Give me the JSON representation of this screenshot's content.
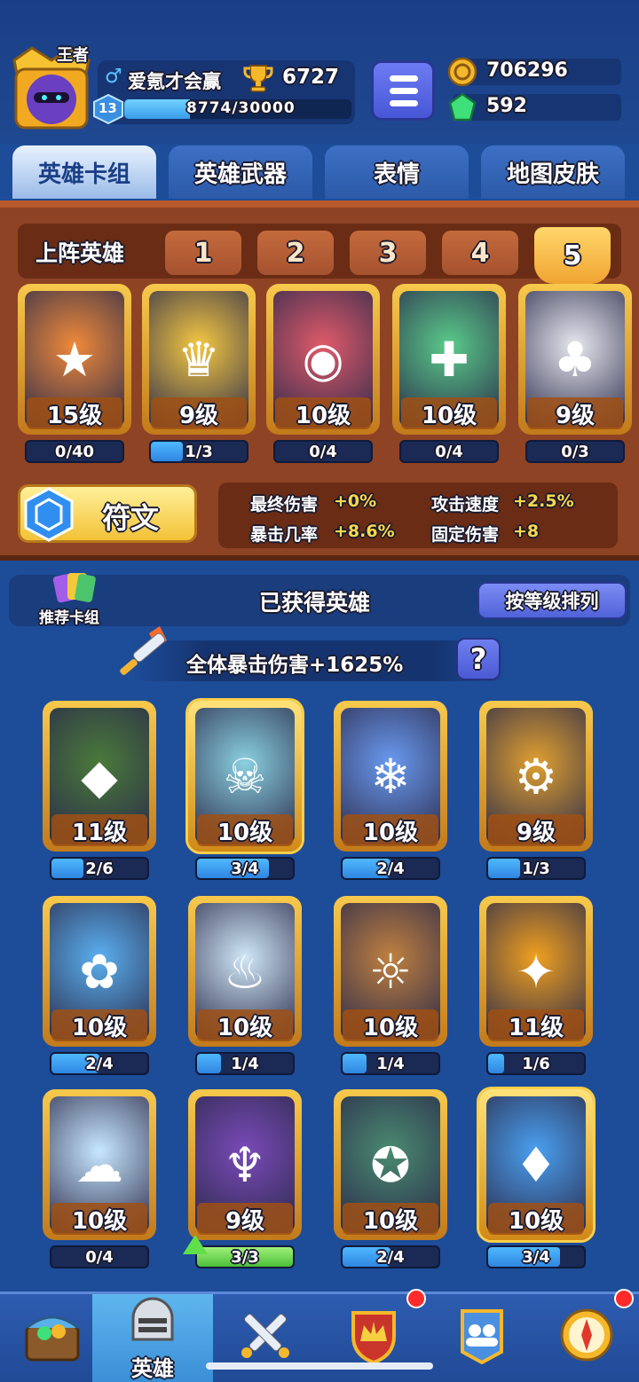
{
  "player": {
    "rank_badge": "王者",
    "gender_symbol": "♂",
    "name": "爱氪才会赢",
    "trophies": "6727",
    "level": "13",
    "xp_text": "8774/30000",
    "xp_fraction": 0.29
  },
  "resources": {
    "coins": "706296",
    "gems": "592"
  },
  "tabs": [
    {
      "label": "英雄卡组"
    },
    {
      "label": "英雄武器"
    },
    {
      "label": "表情"
    },
    {
      "label": "地图皮肤"
    }
  ],
  "lineup": {
    "title": "上阵英雄",
    "deck_numbers": [
      "1",
      "2",
      "3",
      "4",
      "5"
    ],
    "selected_deck": "5",
    "heroes": [
      {
        "level": "15级",
        "progress": "0/40",
        "fraction": 0.0,
        "icon": "monkey-king-icon"
      },
      {
        "level": "9级",
        "progress": "1/3",
        "fraction": 0.33,
        "icon": "chef-icon"
      },
      {
        "level": "10级",
        "progress": "0/4",
        "fraction": 0.0,
        "icon": "pink-monocle-icon"
      },
      {
        "level": "10级",
        "progress": "0/4",
        "fraction": 0.0,
        "icon": "zombie-icon"
      },
      {
        "level": "9级",
        "progress": "0/3",
        "fraction": 0.0,
        "icon": "clown-icon"
      }
    ]
  },
  "rune": {
    "label": "符文",
    "stats": [
      {
        "name": "最终伤害",
        "value": "+0%"
      },
      {
        "name": "攻击速度",
        "value": "+2.5%"
      },
      {
        "name": "暴击几率",
        "value": "+8.6%"
      },
      {
        "name": "固定伤害",
        "value": "+8"
      }
    ]
  },
  "owned": {
    "recommend_label": "推荐卡组",
    "title": "已获得英雄",
    "sort_label": "按等级排列",
    "crit_bonus": "全体暴击伤害+1625%",
    "help": "?",
    "heroes": [
      {
        "level": "11级",
        "progress": "2/6",
        "fraction": 0.33,
        "icon": "green-goblin-icon"
      },
      {
        "level": "10级",
        "progress": "3/4",
        "fraction": 0.75,
        "icon": "skull-knight-icon",
        "crown": true
      },
      {
        "level": "10级",
        "progress": "2/4",
        "fraction": 0.5,
        "icon": "blue-wizard-icon"
      },
      {
        "level": "9级",
        "progress": "1/3",
        "fraction": 0.33,
        "icon": "helmet-bean-icon"
      },
      {
        "level": "10级",
        "progress": "2/4",
        "fraction": 0.5,
        "icon": "blue-hair-girl-icon"
      },
      {
        "level": "10级",
        "progress": "1/4",
        "fraction": 0.25,
        "icon": "zeus-icon"
      },
      {
        "level": "10级",
        "progress": "1/4",
        "fraction": 0.25,
        "icon": "cowboy-icon"
      },
      {
        "level": "11级",
        "progress": "1/6",
        "fraction": 0.17,
        "icon": "mustache-bean-icon"
      },
      {
        "level": "10级",
        "progress": "0/4",
        "fraction": 0.0,
        "icon": "yeti-icon"
      },
      {
        "level": "9级",
        "progress": "3/3",
        "fraction": 1.0,
        "icon": "octopus-pirate-icon",
        "upgradable": true
      },
      {
        "level": "10级",
        "progress": "2/4",
        "fraction": 0.5,
        "icon": "police-sunglasses-icon"
      },
      {
        "level": "10级",
        "progress": "3/4",
        "fraction": 0.75,
        "icon": "ice-golem-icon",
        "crown": true
      }
    ]
  },
  "nav": {
    "active_label": "英雄",
    "items": [
      {
        "icon": "treasure-chest-icon"
      },
      {
        "icon": "knight-helmet-icon",
        "label": "英雄"
      },
      {
        "icon": "crossed-swords-icon"
      },
      {
        "icon": "crown-shield-icon"
      },
      {
        "icon": "friends-banner-icon"
      },
      {
        "icon": "compass-icon"
      }
    ]
  }
}
